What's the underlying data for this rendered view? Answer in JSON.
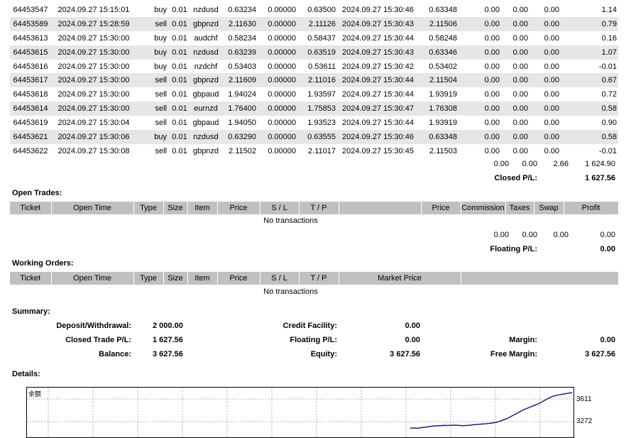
{
  "closed_trades": {
    "rows": [
      {
        "ticket": "64453547",
        "open_time": "2024.09.27 15:15:01",
        "type": "buy",
        "size": "0.01",
        "item": "nzdusd",
        "price": "0.63234",
        "sl": "0.00000",
        "tp": "0.63500",
        "close_time": "2024.09.27 15:30:46",
        "close_price": "0.63348",
        "commission": "0.00",
        "taxes": "0.00",
        "swap": "0.00",
        "profit": "1.14"
      },
      {
        "ticket": "64453589",
        "open_time": "2024.09.27 15:28:59",
        "type": "sell",
        "size": "0.01",
        "item": "gbpnzd",
        "price": "2.11630",
        "sl": "0.00000",
        "tp": "2.11126",
        "close_time": "2024.09.27 15:30:43",
        "close_price": "2.11506",
        "commission": "0.00",
        "taxes": "0.00",
        "swap": "0.00",
        "profit": "0.79"
      },
      {
        "ticket": "64453613",
        "open_time": "2024.09.27 15:30:00",
        "type": "buy",
        "size": "0.01",
        "item": "audchf",
        "price": "0.58234",
        "sl": "0.00000",
        "tp": "0.58437",
        "close_time": "2024.09.27 15:30:44",
        "close_price": "0.58248",
        "commission": "0.00",
        "taxes": "0.00",
        "swap": "0.00",
        "profit": "0.16"
      },
      {
        "ticket": "64453615",
        "open_time": "2024.09.27 15:30:00",
        "type": "buy",
        "size": "0.01",
        "item": "nzdusd",
        "price": "0.63239",
        "sl": "0.00000",
        "tp": "0.63519",
        "close_time": "2024.09.27 15:30:43",
        "close_price": "0.63346",
        "commission": "0.00",
        "taxes": "0.00",
        "swap": "0.00",
        "profit": "1.07"
      },
      {
        "ticket": "64453616",
        "open_time": "2024.09.27 15:30:00",
        "type": "buy",
        "size": "0.01",
        "item": "nzdchf",
        "price": "0.53403",
        "sl": "0.00000",
        "tp": "0.53611",
        "close_time": "2024.09.27 15:30:42",
        "close_price": "0.53402",
        "commission": "0.00",
        "taxes": "0.00",
        "swap": "0.00",
        "profit": "-0.01"
      },
      {
        "ticket": "64453617",
        "open_time": "2024.09.27 15:30:00",
        "type": "sell",
        "size": "0.01",
        "item": "gbpnzd",
        "price": "2.11609",
        "sl": "0.00000",
        "tp": "2.11016",
        "close_time": "2024.09.27 15:30:44",
        "close_price": "2.11504",
        "commission": "0.00",
        "taxes": "0.00",
        "swap": "0.00",
        "profit": "0.67"
      },
      {
        "ticket": "64453618",
        "open_time": "2024.09.27 15:30:00",
        "type": "sell",
        "size": "0.01",
        "item": "gbpaud",
        "price": "1.94024",
        "sl": "0.00000",
        "tp": "1.93597",
        "close_time": "2024.09.27 15:30:44",
        "close_price": "1.93919",
        "commission": "0.00",
        "taxes": "0.00",
        "swap": "0.00",
        "profit": "0.72"
      },
      {
        "ticket": "64453614",
        "open_time": "2024.09.27 15:30:00",
        "type": "sell",
        "size": "0.01",
        "item": "eurnzd",
        "price": "1.76400",
        "sl": "0.00000",
        "tp": "1.75853",
        "close_time": "2024.09.27 15:30:47",
        "close_price": "1.76308",
        "commission": "0.00",
        "taxes": "0.00",
        "swap": "0.00",
        "profit": "0.58"
      },
      {
        "ticket": "64453619",
        "open_time": "2024.09.27 15:30:04",
        "type": "sell",
        "size": "0.01",
        "item": "gbpaud",
        "price": "1.94050",
        "sl": "0.00000",
        "tp": "1.93523",
        "close_time": "2024.09.27 15:30:44",
        "close_price": "1.93919",
        "commission": "0.00",
        "taxes": "0.00",
        "swap": "0.00",
        "profit": "0.90"
      },
      {
        "ticket": "64453621",
        "open_time": "2024.09.27 15:30:06",
        "type": "buy",
        "size": "0.01",
        "item": "nzdusd",
        "price": "0.63290",
        "sl": "0.00000",
        "tp": "0.63555",
        "close_time": "2024.09.27 15:30:46",
        "close_price": "0.63348",
        "commission": "0.00",
        "taxes": "0.00",
        "swap": "0.00",
        "profit": "0.58"
      },
      {
        "ticket": "64453622",
        "open_time": "2024.09.27 15:30:08",
        "type": "sell",
        "size": "0.01",
        "item": "gbpnzd",
        "price": "2.11502",
        "sl": "0.00000",
        "tp": "2.11017",
        "close_time": "2024.09.27 15:30:45",
        "close_price": "2.11503",
        "commission": "0.00",
        "taxes": "0.00",
        "swap": "0.00",
        "profit": "-0.01"
      }
    ],
    "totals": {
      "commission": "0.00",
      "taxes": "0.00",
      "swap": "2.66",
      "profit": "1 624.90"
    },
    "closed_pl_label": "Closed P/L:",
    "closed_pl_value": "1 627.56"
  },
  "open_trades": {
    "title": "Open Trades:",
    "headers": [
      "Ticket",
      "Open Time",
      "Type",
      "Size",
      "Item",
      "Price",
      "S / L",
      "T / P",
      "",
      "Price",
      "Commission",
      "Taxes",
      "Swap",
      "Profit"
    ],
    "empty_text": "No transactions",
    "totals": {
      "commission": "0.00",
      "taxes": "0.00",
      "swap": "0.00",
      "profit": "0.00"
    },
    "floating_label": "Floating P/L:",
    "floating_value": "0.00"
  },
  "working_orders": {
    "title": "Working Orders:",
    "headers": [
      "Ticket",
      "Open Time",
      "Type",
      "Size",
      "Item",
      "Price",
      "S / L",
      "T / P",
      "Market Price",
      ""
    ],
    "empty_text": "No transactions"
  },
  "summary": {
    "title": "Summary:",
    "deposit_label": "Deposit/Withdrawal:",
    "deposit_value": "2 000.00",
    "credit_label": "Credit Facility:",
    "credit_value": "0.00",
    "closed_label": "Closed Trade P/L:",
    "closed_value": "1 627.56",
    "floating_label": "Floating P/L:",
    "floating_value": "0.00",
    "margin_label": "Margin:",
    "margin_value": "0.00",
    "balance_label": "Balance:",
    "balance_value": "3 627.56",
    "equity_label": "Equity:",
    "equity_value": "3 627.56",
    "free_margin_label": "Free Margin:",
    "free_margin_value": "3 627.56"
  },
  "details": {
    "title": "Details:",
    "chart_data": {
      "type": "line",
      "title": "余额",
      "y_ticks": [
        "3611",
        "3272"
      ],
      "ylim": [
        3170,
        3660
      ],
      "color": "#1a237e",
      "values": [
        3260,
        3262,
        3258,
        3265,
        3270,
        3275,
        3280,
        3283,
        3285,
        3287,
        3286,
        3288,
        3290,
        3287,
        3284,
        3286,
        3290,
        3295,
        3298,
        3300,
        3303,
        3307,
        3312,
        3320,
        3330,
        3345,
        3360,
        3380,
        3400,
        3420,
        3440,
        3455,
        3470,
        3485,
        3500,
        3520,
        3540,
        3560,
        3575,
        3585,
        3592,
        3598,
        3605,
        3611
      ]
    }
  }
}
